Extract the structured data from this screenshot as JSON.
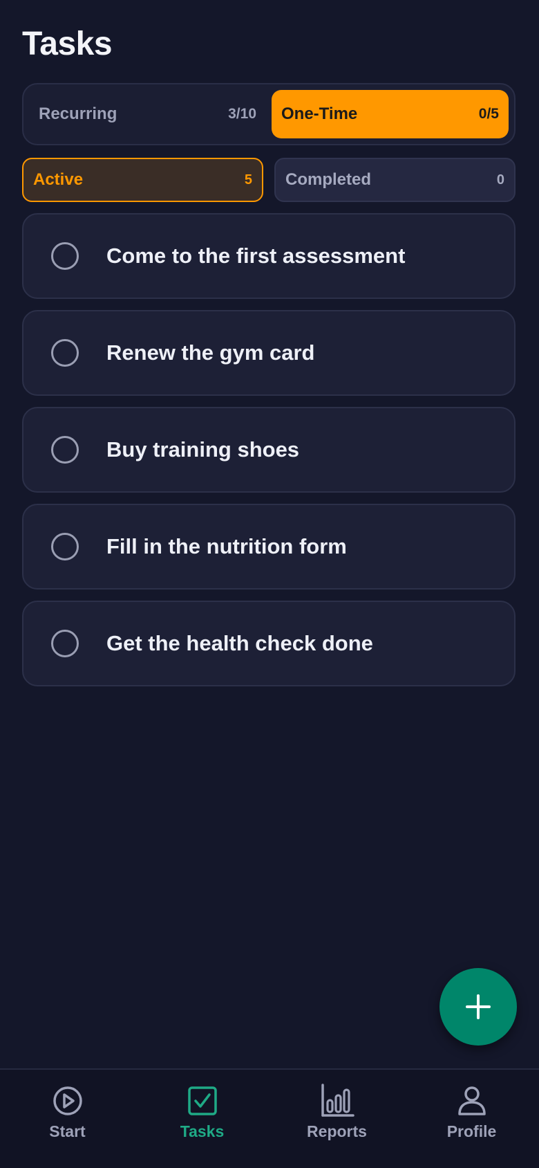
{
  "page": {
    "title": "Tasks"
  },
  "type_tabs": [
    {
      "label": "Recurring",
      "count": "3/10",
      "active": false
    },
    {
      "label": "One-Time",
      "count": "0/5",
      "active": true
    }
  ],
  "status_tabs": [
    {
      "label": "Active",
      "count": "5",
      "active": true
    },
    {
      "label": "Completed",
      "count": "0",
      "active": false
    }
  ],
  "tasks": [
    {
      "label": "Come to the first assessment",
      "done": false
    },
    {
      "label": "Renew the gym card",
      "done": false
    },
    {
      "label": "Buy training shoes",
      "done": false
    },
    {
      "label": "Fill in the nutrition form",
      "done": false
    },
    {
      "label": "Get the health check done",
      "done": false
    }
  ],
  "fab": {
    "icon": "plus-icon"
  },
  "nav": [
    {
      "label": "Start",
      "icon": "play-circle-icon",
      "active": false
    },
    {
      "label": "Tasks",
      "icon": "checkbox-icon",
      "active": true
    },
    {
      "label": "Reports",
      "icon": "bar-chart-icon",
      "active": false
    },
    {
      "label": "Profile",
      "icon": "person-icon",
      "active": false
    }
  ],
  "colors": {
    "background": "#14172a",
    "accent_orange": "#ff9800",
    "accent_green": "#00866a",
    "nav_active": "#1faa86"
  }
}
